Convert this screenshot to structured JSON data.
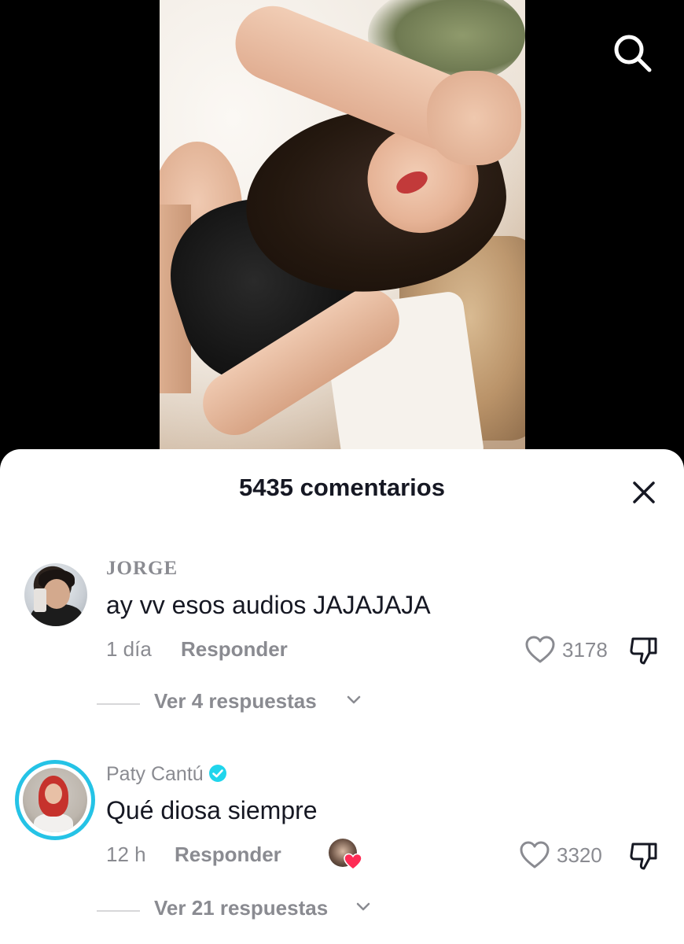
{
  "sheet": {
    "title": "5435 comentarios"
  },
  "comments": [
    {
      "username": "JORGE",
      "text": "ay vv esos audios JAJAJAJA",
      "time": "1 día",
      "reply_label": "Responder",
      "likes": "3178",
      "view_replies": "Ver 4 respuestas",
      "verified": false
    },
    {
      "username": "Paty Cantú",
      "text": "Qué diosa siempre",
      "time": "12 h",
      "reply_label": "Responder",
      "likes": "3320",
      "view_replies": "Ver 21 respuestas",
      "verified": true,
      "liked_by_creator": true
    }
  ],
  "colors": {
    "verified": "#20d5ec",
    "story_ring": "#25c3e6",
    "heart": "#fe2c55",
    "muted": "#8a8b91",
    "text": "#161823"
  },
  "icons": [
    "search-icon",
    "close-icon",
    "heart-outline-icon",
    "thumbs-down-icon",
    "chevron-down-icon",
    "verified-badge-icon"
  ]
}
